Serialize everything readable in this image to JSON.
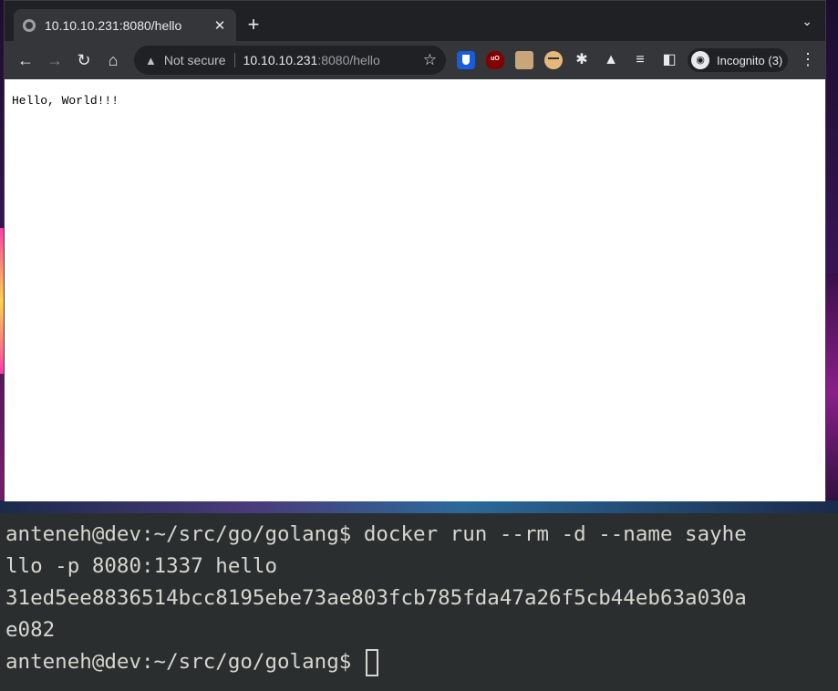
{
  "browser": {
    "tab": {
      "title": "10.10.10.231:8080/hello",
      "close_glyph": "✕"
    },
    "newtab_glyph": "+",
    "tab_search_glyph": "⌄",
    "nav": {
      "back": "←",
      "forward": "→",
      "reload": "↻",
      "home": "⌂"
    },
    "omnibox": {
      "security_label": "Not secure",
      "url_host": "10.10.10.231",
      "url_rest": ":8080/hello",
      "bookmark_glyph": "☆"
    },
    "extensions": [
      "bitwarden-icon",
      "ublock-icon",
      "tab-manager-icon",
      "face-icon",
      "puzzle-icon",
      "labs-icon",
      "media-icon",
      "side-panel-icon"
    ],
    "ublock_text": "uO",
    "toolbar_glyphs": {
      "puzzle": "✱",
      "labs": "▲",
      "media": "≡",
      "side_panel": "◧"
    },
    "profile": {
      "label": "Incognito (3)",
      "avatar_glyph": "◉"
    },
    "menu_glyph": "⋮",
    "page": {
      "text": "Hello, World!!!"
    }
  },
  "terminal": {
    "lines": [
      "anteneh@dev:~/src/go/golang$ docker run --rm -d --name sayhe",
      "llo -p 8080:1337 hello",
      "31ed5ee8836514bcc8195ebe73ae803fcb785fda47a26f5cb44eb63a030a",
      "e082",
      "anteneh@dev:~/src/go/golang$ "
    ]
  },
  "colors": {
    "chrome_dark": "#202124",
    "toolbar": "#35363a",
    "terminal_bg": "#2b2e2f",
    "terminal_fg": "#d3d7cf"
  }
}
